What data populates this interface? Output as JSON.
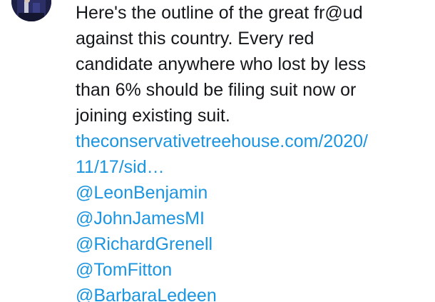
{
  "tweet": {
    "text_lines": [
      "Here's the outline of the great fr@ud",
      "against this country. Every red",
      "candidate anywhere who lost by less",
      "than 6% should be filing suit now or",
      "joining existing suit."
    ],
    "link": {
      "line1": "theconservativetreehouse.com/2020/",
      "line2": "11/17/sid…"
    },
    "mentions": [
      "@LeonBenjamin",
      "@JohnJamesMI",
      "@RichardGrenell",
      "@TomFitton",
      "@BarbaraLedeen"
    ]
  },
  "colors": {
    "text": "#14171a",
    "link": "#1b95e0",
    "background": "#ffffff"
  },
  "icons": {
    "avatar": "user-avatar"
  }
}
